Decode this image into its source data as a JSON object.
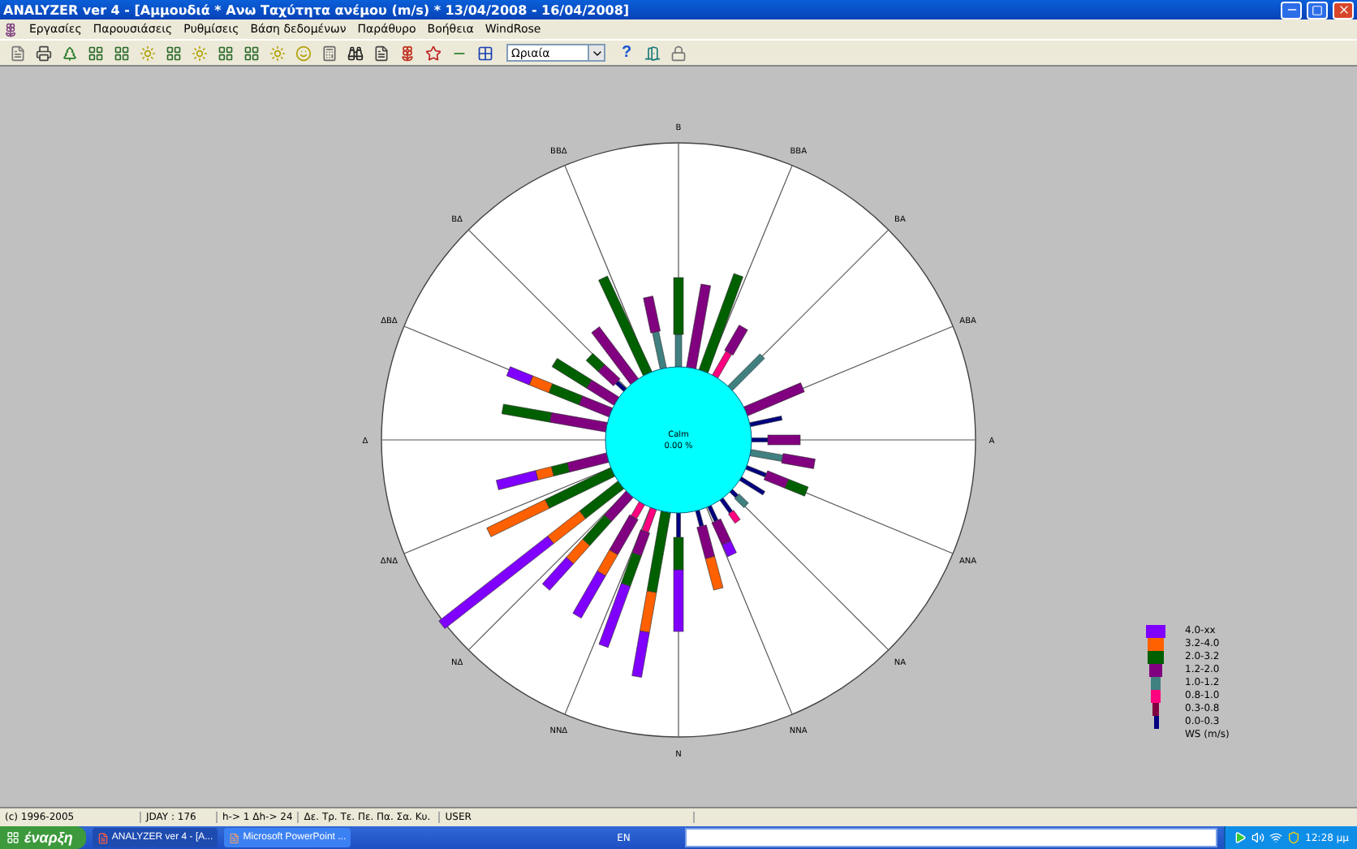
{
  "window": {
    "title": "ANALYZER ver 4 - [Αμμουδιά * Ανω Ταχύτητα ανέμου (m/s)  * 13/04/2008 -  16/04/2008]"
  },
  "menu": [
    "Εργασίες",
    "Παρουσιάσεις",
    "Ρυθμίσεις",
    "Βάση δεδομένων",
    "Παράθυρο",
    "Βοήθεια",
    "WindRose"
  ],
  "toolbar": {
    "period_select": {
      "value": "Ωριαία"
    },
    "help": "?"
  },
  "wind_rose": {
    "directions": [
      "Β",
      "ΒΒΑ",
      "ΒΑ",
      "ΑΒΑ",
      "Α",
      "ΑΝΑ",
      "ΝΑ",
      "ΝΝΑ",
      "Ν",
      "ΝΝΔ",
      "ΝΔ",
      "ΔΝΔ",
      "Δ",
      "ΔΒΔ",
      "ΒΔ",
      "ΒΒΔ"
    ],
    "calm_label": "Calm",
    "calm_value": "0.00 %"
  },
  "legend": {
    "items": [
      {
        "label": "4.0-xx",
        "color": "#8000ff"
      },
      {
        "label": "3.2-4.0",
        "color": "#ff6000"
      },
      {
        "label": "2.0-3.2",
        "color": "#006000"
      },
      {
        "label": "1.2-2.0",
        "color": "#800080"
      },
      {
        "label": "1.0-1.2",
        "color": "#408080"
      },
      {
        "label": "0.8-1.0",
        "color": "#ff0080"
      },
      {
        "label": "0.3-0.8",
        "color": "#800040"
      },
      {
        "label": "0.0-0.3",
        "color": "#000080"
      }
    ],
    "unit": "WS (m/s)"
  },
  "status_bar": [
    "(c) 1996-2005",
    "JDAY : 176",
    "h-> 1   Δh-> 24",
    "Δε. Τρ. Τε. Πε. Πα. Σα. Κυ.",
    "USER"
  ],
  "taskbar": {
    "start": "έναρξη",
    "tasks": [
      {
        "label": "ANALYZER ver 4 - [A...",
        "selected": true
      },
      {
        "label": "Microsoft PowerPoint ...",
        "selected": false
      }
    ],
    "language": "EN",
    "clock": "12:28 μμ"
  }
}
